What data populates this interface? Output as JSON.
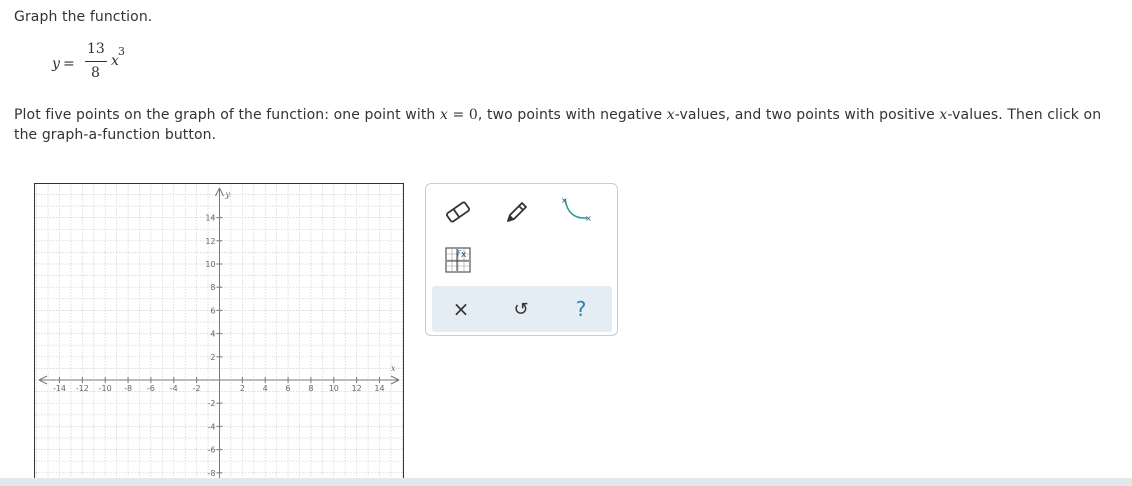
{
  "question": {
    "title": "Graph the function.",
    "equation": {
      "lhs": "y",
      "eq": "=",
      "numerator": "13",
      "denominator": "8",
      "var": "x",
      "exponent": "3"
    },
    "instruction": {
      "p1": "Plot five points on the graph of the function: one point with ",
      "x1": "x",
      "eq1": " = 0",
      "p2": ", two points with negative ",
      "x2": "x",
      "p3": "-values, and two points with positive ",
      "x3": "x",
      "p4": "-values. Then click on the graph-a-function button."
    }
  },
  "graph": {
    "x_axis_label": "x",
    "y_axis_label": "y",
    "x_ticks": [
      "-14",
      "-12",
      "-10",
      "-8",
      "-6",
      "-4",
      "-2",
      "2",
      "4",
      "6",
      "8",
      "10",
      "12",
      "14"
    ],
    "y_ticks": [
      "14",
      "12",
      "10",
      "8",
      "6",
      "4",
      "2",
      "-2",
      "-4",
      "-6",
      "-8"
    ]
  },
  "tools": {
    "items": [
      {
        "name": "eraser-icon",
        "label": "eraser"
      },
      {
        "name": "pencil-icon",
        "label": "pencil"
      },
      {
        "name": "curve-tool-icon",
        "label": "curve"
      },
      {
        "name": "graph-function-icon",
        "label": "graph-a-function"
      }
    ],
    "bar": {
      "clear": "×",
      "undo": "↺",
      "help": "?"
    },
    "accent": "#2f7fb0",
    "curve_color": "#2a9d8f"
  }
}
